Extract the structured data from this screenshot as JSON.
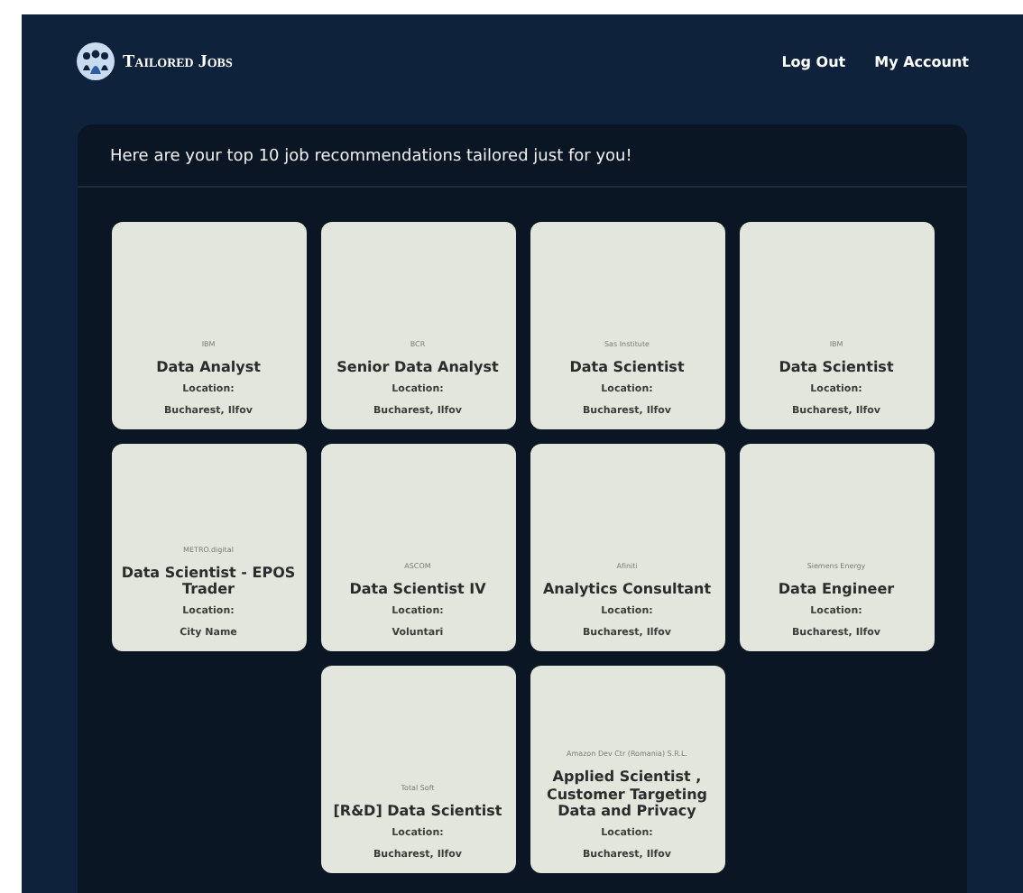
{
  "header": {
    "brand": "Tailored Jobs",
    "nav": [
      "Log Out",
      "My Account"
    ]
  },
  "panel": {
    "heading": "Here are your top 10 job recommendations tailored just for you!",
    "jobs": [
      {
        "company": "IBM",
        "title": "Data Analyst",
        "location_label": "Location:",
        "location": "Bucharest, Ilfov"
      },
      {
        "company": "BCR",
        "title": "Senior Data Analyst",
        "location_label": "Location:",
        "location": "Bucharest, Ilfov"
      },
      {
        "company": "Sas Institute",
        "title": "Data Scientist",
        "location_label": "Location:",
        "location": "Bucharest, Ilfov"
      },
      {
        "company": "IBM",
        "title": "Data Scientist",
        "location_label": "Location:",
        "location": "Bucharest, Ilfov"
      },
      {
        "company": "METRO.digital",
        "title": "Data Scientist - EPOS Trader",
        "location_label": "Location:",
        "location": "City Name"
      },
      {
        "company": "ASCOM",
        "title": "Data Scientist IV",
        "location_label": "Location:",
        "location": "Voluntari"
      },
      {
        "company": "Afiniti",
        "title": "Analytics Consultant",
        "location_label": "Location:",
        "location": "Bucharest, Ilfov"
      },
      {
        "company": "Siemens Energy",
        "title": "Data Engineer",
        "location_label": "Location:",
        "location": "Bucharest, Ilfov"
      },
      {
        "company": "Total Soft",
        "title": "[R&D] Data Scientist",
        "location_label": "Location:",
        "location": "Bucharest, Ilfov"
      },
      {
        "company": "Amazon Dev Ctr (Romania) S.R.L.",
        "title": "Applied Scientist , Customer Targeting Data and Privacy",
        "location_label": "Location:",
        "location": "Bucharest, Ilfov"
      }
    ]
  }
}
